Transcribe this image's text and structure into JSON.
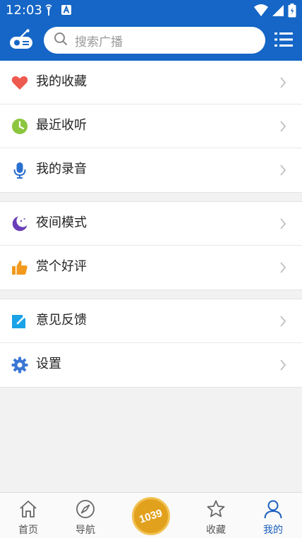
{
  "status_bar": {
    "time": "12:03",
    "bg": "#1566c6"
  },
  "header": {
    "search_placeholder": "搜索广播",
    "left_icon": "radio-icon",
    "right_icon": "list-menu-icon"
  },
  "menu_groups": [
    {
      "items": [
        {
          "label": "我的收藏",
          "icon": "heart-icon",
          "color": "#ee5a4f"
        },
        {
          "label": "最近收听",
          "icon": "clock-icon",
          "color": "#8cc63e"
        },
        {
          "label": "我的录音",
          "icon": "microphone-icon",
          "color": "#2a6fd0"
        }
      ]
    },
    {
      "items": [
        {
          "label": "夜间模式",
          "icon": "moon-icon",
          "color": "#6a3fb8"
        },
        {
          "label": "赏个好评",
          "icon": "thumbs-up-icon",
          "color": "#f29a1e"
        }
      ]
    },
    {
      "items": [
        {
          "label": "意见反馈",
          "icon": "feedback-edit-icon",
          "color": "#1aa3e6"
        },
        {
          "label": "设置",
          "icon": "gear-icon",
          "color": "#3a78d4"
        }
      ]
    }
  ],
  "tab_bar": {
    "tabs": [
      {
        "label": "首页",
        "icon": "home-icon"
      },
      {
        "label": "导航",
        "icon": "compass-icon"
      },
      {
        "label": "收藏",
        "icon": "star-icon"
      },
      {
        "label": "我的",
        "icon": "person-icon",
        "active": true
      }
    ],
    "center_logo_text": "1039",
    "active_color": "#1b5fbf"
  }
}
